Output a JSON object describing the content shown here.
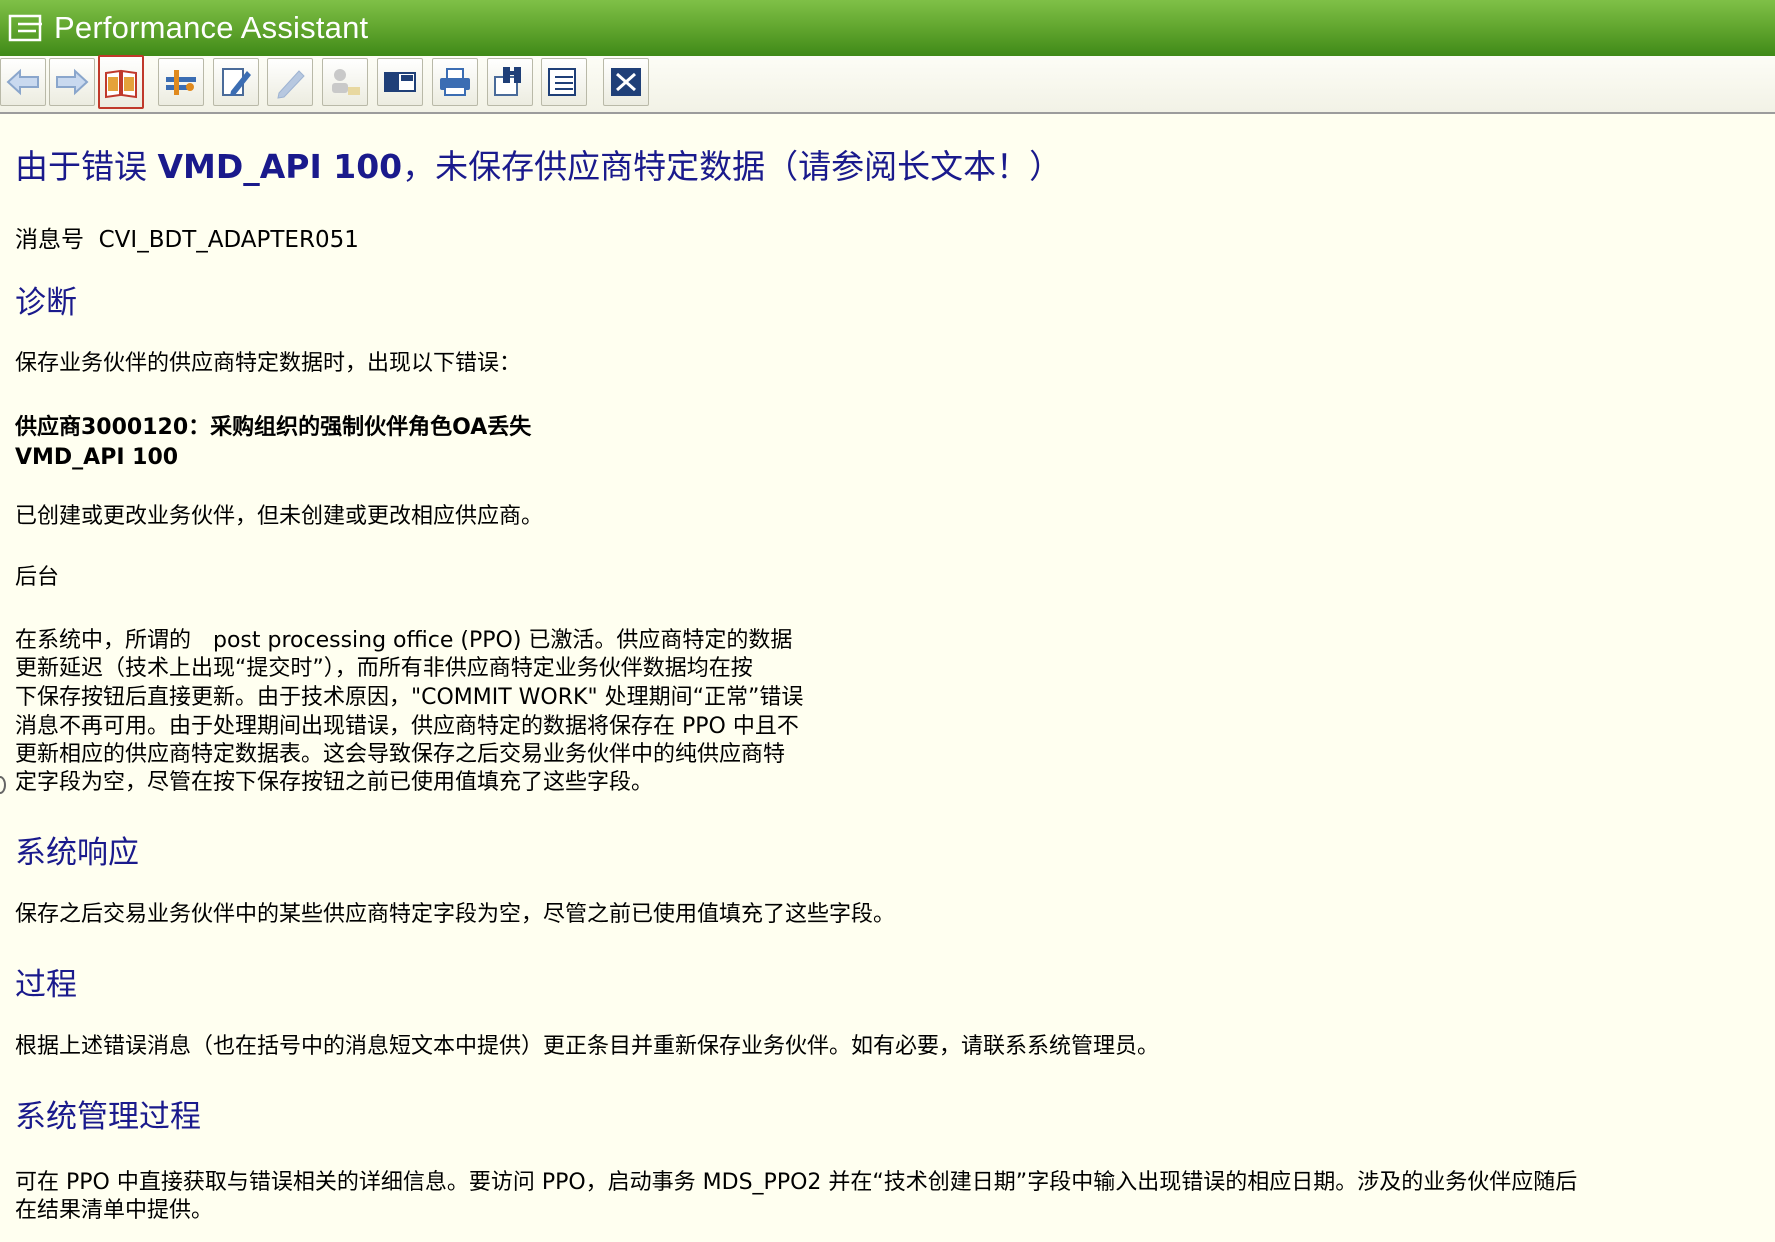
{
  "window": {
    "title": "Performance Assistant",
    "title_bar_color": "#5ea32c",
    "background_color": "#fffff0",
    "heading_color": "#1a1a8c"
  },
  "toolbar": {
    "buttons": [
      {
        "name": "back-button",
        "icon": "arrow-left-icon"
      },
      {
        "name": "forward-button",
        "icon": "arrow-right-icon"
      },
      {
        "name": "long-text-button",
        "icon": "open-book-icon",
        "active": true
      },
      {
        "name": "technical-info-button",
        "icon": "tools-icon"
      },
      {
        "name": "edit-button",
        "icon": "pencil-doc-icon"
      },
      {
        "name": "edit-disabled-button",
        "icon": "pencil-icon"
      },
      {
        "name": "user-button",
        "icon": "person-icon"
      },
      {
        "name": "window-layout-button",
        "icon": "window-layout-icon"
      },
      {
        "name": "print-button",
        "icon": "printer-icon"
      },
      {
        "name": "find-button",
        "icon": "binoculars-icon"
      },
      {
        "name": "settings-button",
        "icon": "doc-list-icon"
      },
      {
        "name": "close-button",
        "icon": "close-icon"
      }
    ]
  },
  "message": {
    "title_prefix": "由于错误 ",
    "title_code": "VMD_API 100",
    "title_suffix": "，未保存供应商特定数据（请参阅长文本！）",
    "number_label": "消息号",
    "number_value": "CVI_BDT_ADAPTER051"
  },
  "sections": {
    "diagnosis": {
      "heading": "诊断",
      "line1": "保存业务伙伴的供应商特定数据时，出现以下错误：",
      "error_line1": "供应商3000120：采购组织的强制伙伴角色OA丢失",
      "error_line2": "VMD_API 100",
      "line2": "已创建或更改业务伙伴，但未创建或更改相应供应商。",
      "background_label": "后台",
      "bg_lines": [
        "在系统中，所谓的　post processing office (PPO) 已激活。供应商特定的数据",
        "更新延迟（技术上出现“提交时”），而所有非供应商特定业务伙伴数据均在按",
        "下保存按钮后直接更新。由于技术原因，\"COMMIT WORK\" 处理期间“正常”错误",
        "消息不再可用。由于处理期间出现错误，供应商特定的数据将保存在  PPO 中且不",
        "更新相应的供应商特定数据表。这会导致保存之后交易业务伙伴中的纯供应商特",
        "定字段为空，尽管在按下保存按钮之前已使用值填充了这些字段。"
      ]
    },
    "system_response": {
      "heading": "系统响应",
      "text": "保存之后交易业务伙伴中的某些供应商特定字段为空，尽管之前已使用值填充了这些字段。"
    },
    "procedure": {
      "heading": "过程",
      "text": "根据上述错误消息（也在括号中的消息短文本中提供）更正条目并重新保存业务伙伴。如有必要，请联系系统管理员。"
    },
    "admin_procedure": {
      "heading": "系统管理过程",
      "line1": "可在  PPO 中直接获取与错误相关的详细信息。要访问  PPO，启动事务  MDS_PPO2 并在“技术创建日期”字段中输入出现错误的相应日期。涉及的业务伙伴应随后",
      "line2": "在结果清单中提供。"
    }
  }
}
